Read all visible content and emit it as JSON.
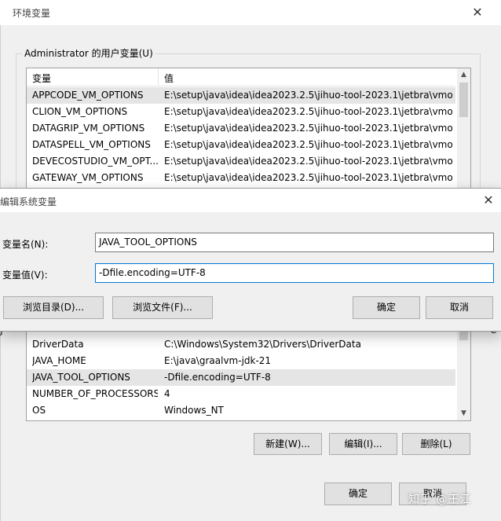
{
  "background_window": {
    "title": "环境变量",
    "user_group_label": "Administrator 的用户变量(U)",
    "columns": [
      "变量",
      "值"
    ],
    "user_rows": [
      {
        "name": "APPCODE_VM_OPTIONS",
        "value": "E:\\setup\\java\\idea\\idea2023.2.5\\jihuo-tool-2023.1\\jetbra\\vmo..."
      },
      {
        "name": "CLION_VM_OPTIONS",
        "value": "E:\\setup\\java\\idea\\idea2023.2.5\\jihuo-tool-2023.1\\jetbra\\vmo..."
      },
      {
        "name": "DATAGRIP_VM_OPTIONS",
        "value": "E:\\setup\\java\\idea\\idea2023.2.5\\jihuo-tool-2023.1\\jetbra\\vmo..."
      },
      {
        "name": "DATASPELL_VM_OPTIONS",
        "value": "E:\\setup\\java\\idea\\idea2023.2.5\\jihuo-tool-2023.1\\jetbra\\vmo..."
      },
      {
        "name": "DEVECOSTUDIO_VM_OPT...",
        "value": "E:\\setup\\java\\idea\\idea2023.2.5\\jihuo-tool-2023.1\\jetbra\\vmo..."
      },
      {
        "name": "GATEWAY_VM_OPTIONS",
        "value": "E:\\setup\\java\\idea\\idea2023.2.5\\jihuo-tool-2023.1\\jetbra\\vmo..."
      }
    ],
    "system_rows": [
      {
        "name": "DriverData",
        "value": "C:\\Windows\\System32\\Drivers\\DriverData"
      },
      {
        "name": "JAVA_HOME",
        "value": "E:\\java\\graalvm-jdk-21"
      },
      {
        "name": "JAVA_TOOL_OPTIONS",
        "value": "-Dfile.encoding=UTF-8"
      },
      {
        "name": "NUMBER_OF_PROCESSORS",
        "value": "4"
      },
      {
        "name": "OS",
        "value": "Windows_NT"
      }
    ],
    "buttons": {
      "new": "新建(W)...",
      "edit": "编辑(I)...",
      "delete": "删除(L)",
      "ok": "确定",
      "cancel": "取消"
    }
  },
  "edit_dialog": {
    "title": "编辑系统变量",
    "name_label": "变量名(N):",
    "name_value": "JAVA_TOOL_OPTIONS",
    "value_label": "变量值(V):",
    "value_value": "-Dfile.encoding=UTF-8",
    "buttons": {
      "browse_dir": "浏览目录(D)...",
      "browse_file": "浏览文件(F)...",
      "ok": "确定",
      "cancel": "取消"
    }
  },
  "watermark": "知乎 @王江",
  "icons": {
    "close": "close-icon",
    "scroll_up": "chevron-up-icon",
    "scroll_down": "chevron-down-icon"
  },
  "colors": {
    "accent_focus": "#0078d7",
    "selection": "#e5e5e5"
  }
}
